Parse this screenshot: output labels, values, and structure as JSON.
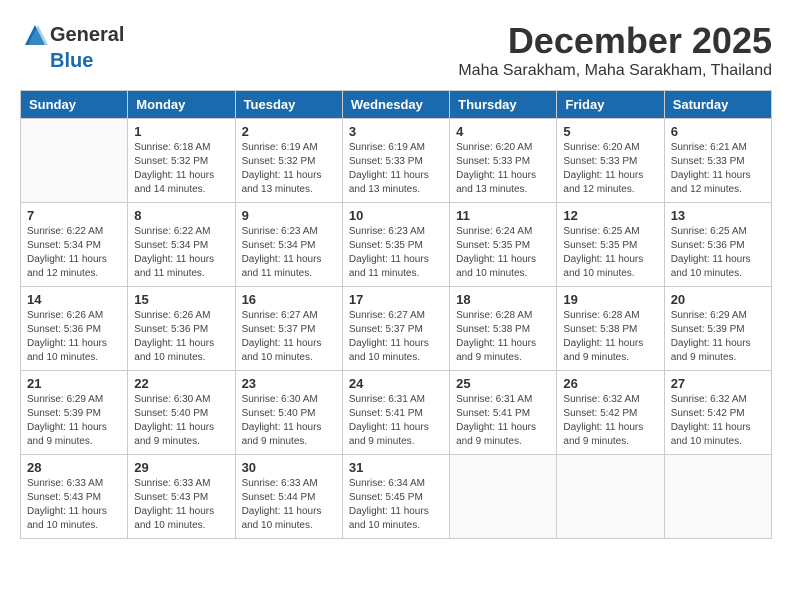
{
  "header": {
    "logo_general": "General",
    "logo_blue": "Blue",
    "title": "December 2025",
    "subtitle": "Maha Sarakham, Maha Sarakham, Thailand"
  },
  "days_of_week": [
    "Sunday",
    "Monday",
    "Tuesday",
    "Wednesday",
    "Thursday",
    "Friday",
    "Saturday"
  ],
  "weeks": [
    [
      {
        "day": "",
        "info": ""
      },
      {
        "day": "1",
        "info": "Sunrise: 6:18 AM\nSunset: 5:32 PM\nDaylight: 11 hours\nand 14 minutes."
      },
      {
        "day": "2",
        "info": "Sunrise: 6:19 AM\nSunset: 5:32 PM\nDaylight: 11 hours\nand 13 minutes."
      },
      {
        "day": "3",
        "info": "Sunrise: 6:19 AM\nSunset: 5:33 PM\nDaylight: 11 hours\nand 13 minutes."
      },
      {
        "day": "4",
        "info": "Sunrise: 6:20 AM\nSunset: 5:33 PM\nDaylight: 11 hours\nand 13 minutes."
      },
      {
        "day": "5",
        "info": "Sunrise: 6:20 AM\nSunset: 5:33 PM\nDaylight: 11 hours\nand 12 minutes."
      },
      {
        "day": "6",
        "info": "Sunrise: 6:21 AM\nSunset: 5:33 PM\nDaylight: 11 hours\nand 12 minutes."
      }
    ],
    [
      {
        "day": "7",
        "info": "Sunrise: 6:22 AM\nSunset: 5:34 PM\nDaylight: 11 hours\nand 12 minutes."
      },
      {
        "day": "8",
        "info": "Sunrise: 6:22 AM\nSunset: 5:34 PM\nDaylight: 11 hours\nand 11 minutes."
      },
      {
        "day": "9",
        "info": "Sunrise: 6:23 AM\nSunset: 5:34 PM\nDaylight: 11 hours\nand 11 minutes."
      },
      {
        "day": "10",
        "info": "Sunrise: 6:23 AM\nSunset: 5:35 PM\nDaylight: 11 hours\nand 11 minutes."
      },
      {
        "day": "11",
        "info": "Sunrise: 6:24 AM\nSunset: 5:35 PM\nDaylight: 11 hours\nand 10 minutes."
      },
      {
        "day": "12",
        "info": "Sunrise: 6:25 AM\nSunset: 5:35 PM\nDaylight: 11 hours\nand 10 minutes."
      },
      {
        "day": "13",
        "info": "Sunrise: 6:25 AM\nSunset: 5:36 PM\nDaylight: 11 hours\nand 10 minutes."
      }
    ],
    [
      {
        "day": "14",
        "info": "Sunrise: 6:26 AM\nSunset: 5:36 PM\nDaylight: 11 hours\nand 10 minutes."
      },
      {
        "day": "15",
        "info": "Sunrise: 6:26 AM\nSunset: 5:36 PM\nDaylight: 11 hours\nand 10 minutes."
      },
      {
        "day": "16",
        "info": "Sunrise: 6:27 AM\nSunset: 5:37 PM\nDaylight: 11 hours\nand 10 minutes."
      },
      {
        "day": "17",
        "info": "Sunrise: 6:27 AM\nSunset: 5:37 PM\nDaylight: 11 hours\nand 10 minutes."
      },
      {
        "day": "18",
        "info": "Sunrise: 6:28 AM\nSunset: 5:38 PM\nDaylight: 11 hours\nand 9 minutes."
      },
      {
        "day": "19",
        "info": "Sunrise: 6:28 AM\nSunset: 5:38 PM\nDaylight: 11 hours\nand 9 minutes."
      },
      {
        "day": "20",
        "info": "Sunrise: 6:29 AM\nSunset: 5:39 PM\nDaylight: 11 hours\nand 9 minutes."
      }
    ],
    [
      {
        "day": "21",
        "info": "Sunrise: 6:29 AM\nSunset: 5:39 PM\nDaylight: 11 hours\nand 9 minutes."
      },
      {
        "day": "22",
        "info": "Sunrise: 6:30 AM\nSunset: 5:40 PM\nDaylight: 11 hours\nand 9 minutes."
      },
      {
        "day": "23",
        "info": "Sunrise: 6:30 AM\nSunset: 5:40 PM\nDaylight: 11 hours\nand 9 minutes."
      },
      {
        "day": "24",
        "info": "Sunrise: 6:31 AM\nSunset: 5:41 PM\nDaylight: 11 hours\nand 9 minutes."
      },
      {
        "day": "25",
        "info": "Sunrise: 6:31 AM\nSunset: 5:41 PM\nDaylight: 11 hours\nand 9 minutes."
      },
      {
        "day": "26",
        "info": "Sunrise: 6:32 AM\nSunset: 5:42 PM\nDaylight: 11 hours\nand 9 minutes."
      },
      {
        "day": "27",
        "info": "Sunrise: 6:32 AM\nSunset: 5:42 PM\nDaylight: 11 hours\nand 10 minutes."
      }
    ],
    [
      {
        "day": "28",
        "info": "Sunrise: 6:33 AM\nSunset: 5:43 PM\nDaylight: 11 hours\nand 10 minutes."
      },
      {
        "day": "29",
        "info": "Sunrise: 6:33 AM\nSunset: 5:43 PM\nDaylight: 11 hours\nand 10 minutes."
      },
      {
        "day": "30",
        "info": "Sunrise: 6:33 AM\nSunset: 5:44 PM\nDaylight: 11 hours\nand 10 minutes."
      },
      {
        "day": "31",
        "info": "Sunrise: 6:34 AM\nSunset: 5:45 PM\nDaylight: 11 hours\nand 10 minutes."
      },
      {
        "day": "",
        "info": ""
      },
      {
        "day": "",
        "info": ""
      },
      {
        "day": "",
        "info": ""
      }
    ]
  ]
}
